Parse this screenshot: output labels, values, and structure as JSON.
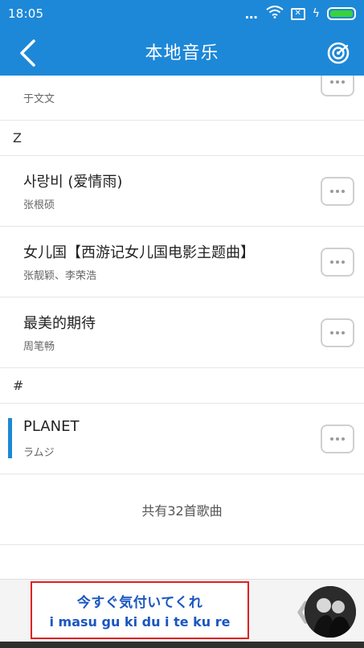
{
  "status": {
    "time": "18:05"
  },
  "header": {
    "title": "本地音乐"
  },
  "list": {
    "partial_item": {
      "artist": "于文文"
    },
    "section_z": "Z",
    "items_z": [
      {
        "title": "사랑비 (爱情雨)",
        "artist": "张根硕"
      },
      {
        "title": "女儿国【西游记女儿国电影主题曲】",
        "artist": "张靓颖、李荣浩"
      },
      {
        "title": "最美的期待",
        "artist": "周笔畅"
      }
    ],
    "section_hash": "#",
    "items_hash": [
      {
        "title": "PLANET",
        "artist": "ラムジ"
      }
    ],
    "total_text": "共有32首歌曲"
  },
  "player": {
    "lyric_line1": "今すぐ気付いてくれ",
    "lyric_line2": "i masu gu ki du i te ku re"
  },
  "colors": {
    "primary": "#1e88d8",
    "lyric_text": "#1a56c0",
    "lyric_border": "#e02020",
    "battery": "#3ad13a"
  },
  "icons": {
    "back": "chevron-left-icon",
    "radar": "radar-icon",
    "more": "more-options-icon",
    "wifi": "wifi-icon",
    "sim": "sim-icon",
    "charging": "charging-icon",
    "battery": "battery-icon"
  }
}
